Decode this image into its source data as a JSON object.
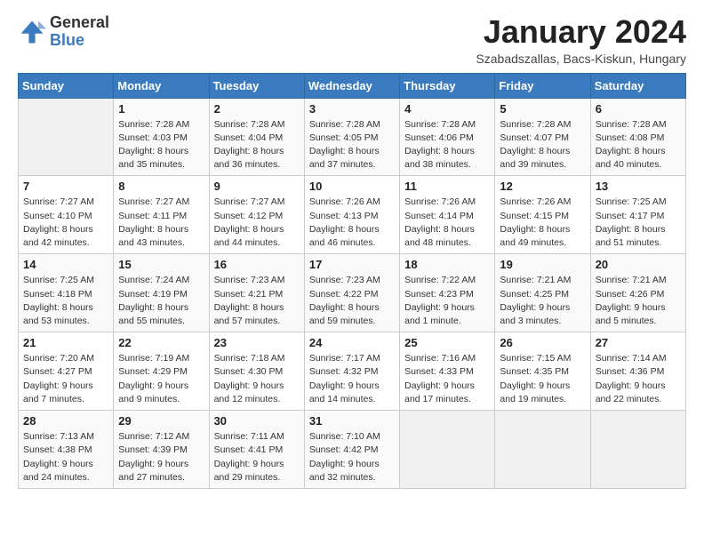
{
  "logo": {
    "general": "General",
    "blue": "Blue"
  },
  "title": "January 2024",
  "subtitle": "Szabadszallas, Bacs-Kiskun, Hungary",
  "weekdays": [
    "Sunday",
    "Monday",
    "Tuesday",
    "Wednesday",
    "Thursday",
    "Friday",
    "Saturday"
  ],
  "weeks": [
    [
      {
        "day": "",
        "sunrise": "",
        "sunset": "",
        "daylight": ""
      },
      {
        "day": "1",
        "sunrise": "Sunrise: 7:28 AM",
        "sunset": "Sunset: 4:03 PM",
        "daylight": "Daylight: 8 hours and 35 minutes."
      },
      {
        "day": "2",
        "sunrise": "Sunrise: 7:28 AM",
        "sunset": "Sunset: 4:04 PM",
        "daylight": "Daylight: 8 hours and 36 minutes."
      },
      {
        "day": "3",
        "sunrise": "Sunrise: 7:28 AM",
        "sunset": "Sunset: 4:05 PM",
        "daylight": "Daylight: 8 hours and 37 minutes."
      },
      {
        "day": "4",
        "sunrise": "Sunrise: 7:28 AM",
        "sunset": "Sunset: 4:06 PM",
        "daylight": "Daylight: 8 hours and 38 minutes."
      },
      {
        "day": "5",
        "sunrise": "Sunrise: 7:28 AM",
        "sunset": "Sunset: 4:07 PM",
        "daylight": "Daylight: 8 hours and 39 minutes."
      },
      {
        "day": "6",
        "sunrise": "Sunrise: 7:28 AM",
        "sunset": "Sunset: 4:08 PM",
        "daylight": "Daylight: 8 hours and 40 minutes."
      }
    ],
    [
      {
        "day": "7",
        "sunrise": "Sunrise: 7:27 AM",
        "sunset": "Sunset: 4:10 PM",
        "daylight": "Daylight: 8 hours and 42 minutes."
      },
      {
        "day": "8",
        "sunrise": "Sunrise: 7:27 AM",
        "sunset": "Sunset: 4:11 PM",
        "daylight": "Daylight: 8 hours and 43 minutes."
      },
      {
        "day": "9",
        "sunrise": "Sunrise: 7:27 AM",
        "sunset": "Sunset: 4:12 PM",
        "daylight": "Daylight: 8 hours and 44 minutes."
      },
      {
        "day": "10",
        "sunrise": "Sunrise: 7:26 AM",
        "sunset": "Sunset: 4:13 PM",
        "daylight": "Daylight: 8 hours and 46 minutes."
      },
      {
        "day": "11",
        "sunrise": "Sunrise: 7:26 AM",
        "sunset": "Sunset: 4:14 PM",
        "daylight": "Daylight: 8 hours and 48 minutes."
      },
      {
        "day": "12",
        "sunrise": "Sunrise: 7:26 AM",
        "sunset": "Sunset: 4:15 PM",
        "daylight": "Daylight: 8 hours and 49 minutes."
      },
      {
        "day": "13",
        "sunrise": "Sunrise: 7:25 AM",
        "sunset": "Sunset: 4:17 PM",
        "daylight": "Daylight: 8 hours and 51 minutes."
      }
    ],
    [
      {
        "day": "14",
        "sunrise": "Sunrise: 7:25 AM",
        "sunset": "Sunset: 4:18 PM",
        "daylight": "Daylight: 8 hours and 53 minutes."
      },
      {
        "day": "15",
        "sunrise": "Sunrise: 7:24 AM",
        "sunset": "Sunset: 4:19 PM",
        "daylight": "Daylight: 8 hours and 55 minutes."
      },
      {
        "day": "16",
        "sunrise": "Sunrise: 7:23 AM",
        "sunset": "Sunset: 4:21 PM",
        "daylight": "Daylight: 8 hours and 57 minutes."
      },
      {
        "day": "17",
        "sunrise": "Sunrise: 7:23 AM",
        "sunset": "Sunset: 4:22 PM",
        "daylight": "Daylight: 8 hours and 59 minutes."
      },
      {
        "day": "18",
        "sunrise": "Sunrise: 7:22 AM",
        "sunset": "Sunset: 4:23 PM",
        "daylight": "Daylight: 9 hours and 1 minute."
      },
      {
        "day": "19",
        "sunrise": "Sunrise: 7:21 AM",
        "sunset": "Sunset: 4:25 PM",
        "daylight": "Daylight: 9 hours and 3 minutes."
      },
      {
        "day": "20",
        "sunrise": "Sunrise: 7:21 AM",
        "sunset": "Sunset: 4:26 PM",
        "daylight": "Daylight: 9 hours and 5 minutes."
      }
    ],
    [
      {
        "day": "21",
        "sunrise": "Sunrise: 7:20 AM",
        "sunset": "Sunset: 4:27 PM",
        "daylight": "Daylight: 9 hours and 7 minutes."
      },
      {
        "day": "22",
        "sunrise": "Sunrise: 7:19 AM",
        "sunset": "Sunset: 4:29 PM",
        "daylight": "Daylight: 9 hours and 9 minutes."
      },
      {
        "day": "23",
        "sunrise": "Sunrise: 7:18 AM",
        "sunset": "Sunset: 4:30 PM",
        "daylight": "Daylight: 9 hours and 12 minutes."
      },
      {
        "day": "24",
        "sunrise": "Sunrise: 7:17 AM",
        "sunset": "Sunset: 4:32 PM",
        "daylight": "Daylight: 9 hours and 14 minutes."
      },
      {
        "day": "25",
        "sunrise": "Sunrise: 7:16 AM",
        "sunset": "Sunset: 4:33 PM",
        "daylight": "Daylight: 9 hours and 17 minutes."
      },
      {
        "day": "26",
        "sunrise": "Sunrise: 7:15 AM",
        "sunset": "Sunset: 4:35 PM",
        "daylight": "Daylight: 9 hours and 19 minutes."
      },
      {
        "day": "27",
        "sunrise": "Sunrise: 7:14 AM",
        "sunset": "Sunset: 4:36 PM",
        "daylight": "Daylight: 9 hours and 22 minutes."
      }
    ],
    [
      {
        "day": "28",
        "sunrise": "Sunrise: 7:13 AM",
        "sunset": "Sunset: 4:38 PM",
        "daylight": "Daylight: 9 hours and 24 minutes."
      },
      {
        "day": "29",
        "sunrise": "Sunrise: 7:12 AM",
        "sunset": "Sunset: 4:39 PM",
        "daylight": "Daylight: 9 hours and 27 minutes."
      },
      {
        "day": "30",
        "sunrise": "Sunrise: 7:11 AM",
        "sunset": "Sunset: 4:41 PM",
        "daylight": "Daylight: 9 hours and 29 minutes."
      },
      {
        "day": "31",
        "sunrise": "Sunrise: 7:10 AM",
        "sunset": "Sunset: 4:42 PM",
        "daylight": "Daylight: 9 hours and 32 minutes."
      },
      {
        "day": "",
        "sunrise": "",
        "sunset": "",
        "daylight": ""
      },
      {
        "day": "",
        "sunrise": "",
        "sunset": "",
        "daylight": ""
      },
      {
        "day": "",
        "sunrise": "",
        "sunset": "",
        "daylight": ""
      }
    ]
  ]
}
